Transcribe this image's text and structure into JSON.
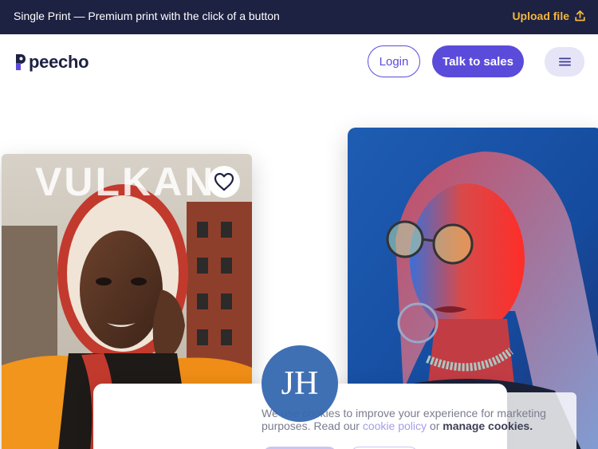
{
  "topbar": {
    "promo_text": "Single Print — Premium print with the click of a button",
    "upload_label": "Upload file",
    "upload_icon": "upload-arrow-icon"
  },
  "nav": {
    "logo_text": "peecho",
    "login_label": "Login",
    "sales_label": "Talk to sales",
    "menu_icon": "hamburger-menu-icon"
  },
  "magazine": {
    "cover_title": "VULKAN"
  },
  "avatar": {
    "initials": "JH"
  },
  "cookie": {
    "text_before": "We use cookies to improve your experience for marketing purposes. Read our ",
    "policy_link": "cookie policy",
    "text_middle": " or ",
    "manage_link": "manage cookies."
  },
  "colors": {
    "topbar_bg": "#1d2142",
    "accent": "#5b4bdb",
    "upload_accent": "#f4b63e"
  }
}
